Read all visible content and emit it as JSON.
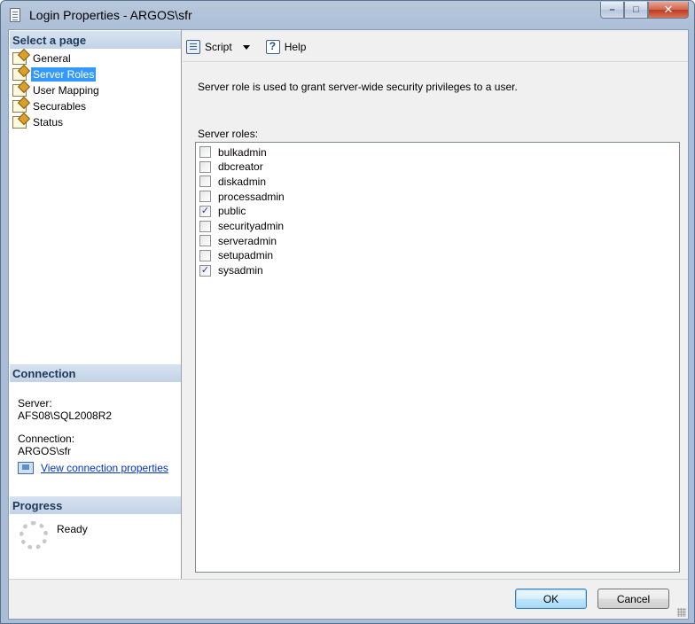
{
  "window": {
    "title": "Login Properties - ARGOS\\sfr",
    "controls": {
      "minimize": "–",
      "maximize": "□",
      "close": "✕"
    }
  },
  "left_panel": {
    "select_page_header": "Select a page",
    "pages": [
      {
        "label": "General",
        "selected": false
      },
      {
        "label": "Server Roles",
        "selected": true
      },
      {
        "label": "User Mapping",
        "selected": false
      },
      {
        "label": "Securables",
        "selected": false
      },
      {
        "label": "Status",
        "selected": false
      }
    ],
    "connection_header": "Connection",
    "server_label": "Server:",
    "server_value": "AFS08\\SQL2008R2",
    "connection_label": "Connection:",
    "connection_value": "ARGOS\\sfr",
    "view_connection_link": "View connection properties",
    "progress_header": "Progress",
    "progress_status": "Ready"
  },
  "toolbar": {
    "script_label": "Script",
    "help_label": "Help"
  },
  "main": {
    "description": "Server role is used to grant server-wide security privileges to a user.",
    "roles_label": "Server roles:",
    "roles": [
      {
        "name": "bulkadmin",
        "checked": false
      },
      {
        "name": "dbcreator",
        "checked": false
      },
      {
        "name": "diskadmin",
        "checked": false
      },
      {
        "name": "processadmin",
        "checked": false
      },
      {
        "name": "public",
        "checked": true
      },
      {
        "name": "securityadmin",
        "checked": false
      },
      {
        "name": "serveradmin",
        "checked": false
      },
      {
        "name": "setupadmin",
        "checked": false
      },
      {
        "name": "sysadmin",
        "checked": true
      }
    ]
  },
  "buttons": {
    "ok": "OK",
    "cancel": "Cancel"
  },
  "colors": {
    "selection": "#3399ff",
    "link": "#0033cc",
    "close_button": "#c0391f"
  }
}
